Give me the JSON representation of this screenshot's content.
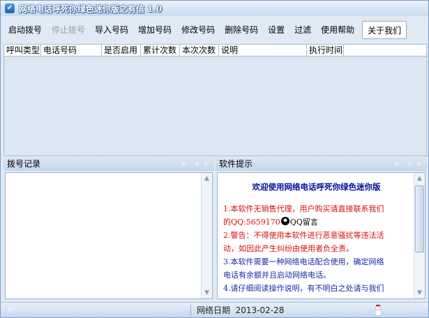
{
  "window": {
    "title": "网络电话呼死你绿色迷你版之有信 1.0",
    "icon": "checkmark-app-icon"
  },
  "toolbar": {
    "buttons": [
      {
        "label": "启动拨号",
        "enabled": true
      },
      {
        "label": "停止拨号",
        "enabled": false
      },
      {
        "label": "导入号码",
        "enabled": true
      },
      {
        "label": "增加号码",
        "enabled": true
      },
      {
        "label": "修改号码",
        "enabled": true
      },
      {
        "label": "删除号码",
        "enabled": true
      },
      {
        "label": "设置",
        "enabled": true
      },
      {
        "label": "过滤",
        "enabled": true
      },
      {
        "label": "使用帮助",
        "enabled": true
      },
      {
        "label": "关于我们",
        "enabled": true
      }
    ]
  },
  "table": {
    "columns": [
      "呼叫类型",
      "电话号码",
      "是否启用",
      "累计次数",
      "本次次数",
      "说明",
      "执行时间"
    ],
    "rows": []
  },
  "dial_log": {
    "header": "拨号记录"
  },
  "tips": {
    "header": "软件提示",
    "title": "欢迎使用网络电话呼死你绿色迷你版",
    "lines": [
      {
        "text": "1.本软件无销售代理，用户购买请直接联系我们",
        "color": "red"
      },
      {
        "text": "的QQ:5659170",
        "color": "red",
        "suffix": "QQ留言",
        "suffix_color": "black"
      },
      {
        "text": "2.警告：不得使用本软件进行恶意骚扰等违法活",
        "color": "red"
      },
      {
        "text": "动，如因此产生纠纷由使用者负全责。",
        "color": "red"
      },
      {
        "text": "3.本软件需要一种网络电话配合使用，确定网络",
        "color": "blue"
      },
      {
        "text": "电话有余额并且启动网络电话。",
        "color": "blue"
      },
      {
        "text": "4.请仔细阅读操作说明，有不明白之处请与我们",
        "color": "blue"
      }
    ]
  },
  "statusbar": {
    "label": "网络日期",
    "date": "2013-02-28"
  },
  "colors": {
    "window_bg": "#dfeaf5",
    "tip_red": "#d41010",
    "tip_blue": "#1a2aa6",
    "tip_title": "#000c9e"
  }
}
